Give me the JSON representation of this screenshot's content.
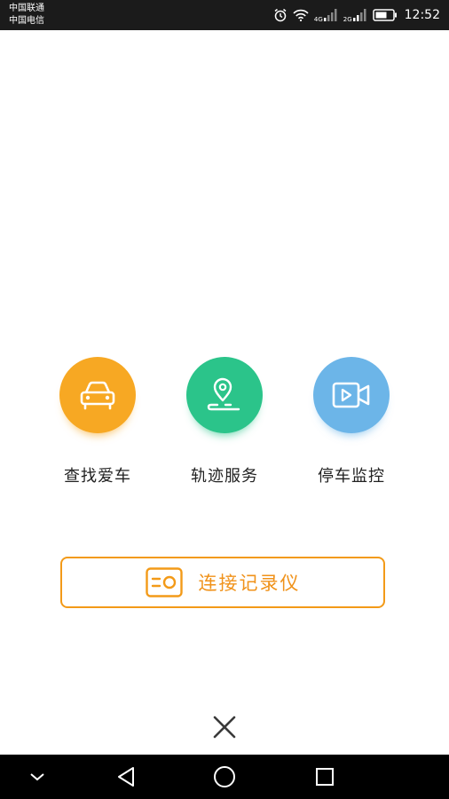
{
  "status_bar": {
    "carrier_1": "中国联通",
    "carrier_2": "中国电信",
    "net_1": "4G",
    "net_2": "2G",
    "time": "12:52",
    "icons": [
      "alarm-icon",
      "wifi-icon",
      "signal-icon",
      "signal-icon",
      "battery-icon"
    ]
  },
  "features": [
    {
      "label": "查找爱车",
      "icon": "car-icon",
      "color": "#f7a823"
    },
    {
      "label": "轨迹服务",
      "icon": "location-pin-icon",
      "color": "#2bc48a"
    },
    {
      "label": "停车监控",
      "icon": "video-camera-icon",
      "color": "#6cb5e8"
    }
  ],
  "connect_button": {
    "label": "连接记录仪",
    "icon": "dashcam-icon",
    "color": "#f39a18"
  },
  "close_icon": "close-icon",
  "nav_bar": {
    "icons": [
      "chevron-down-icon",
      "back-icon",
      "home-icon",
      "recents-icon"
    ]
  }
}
